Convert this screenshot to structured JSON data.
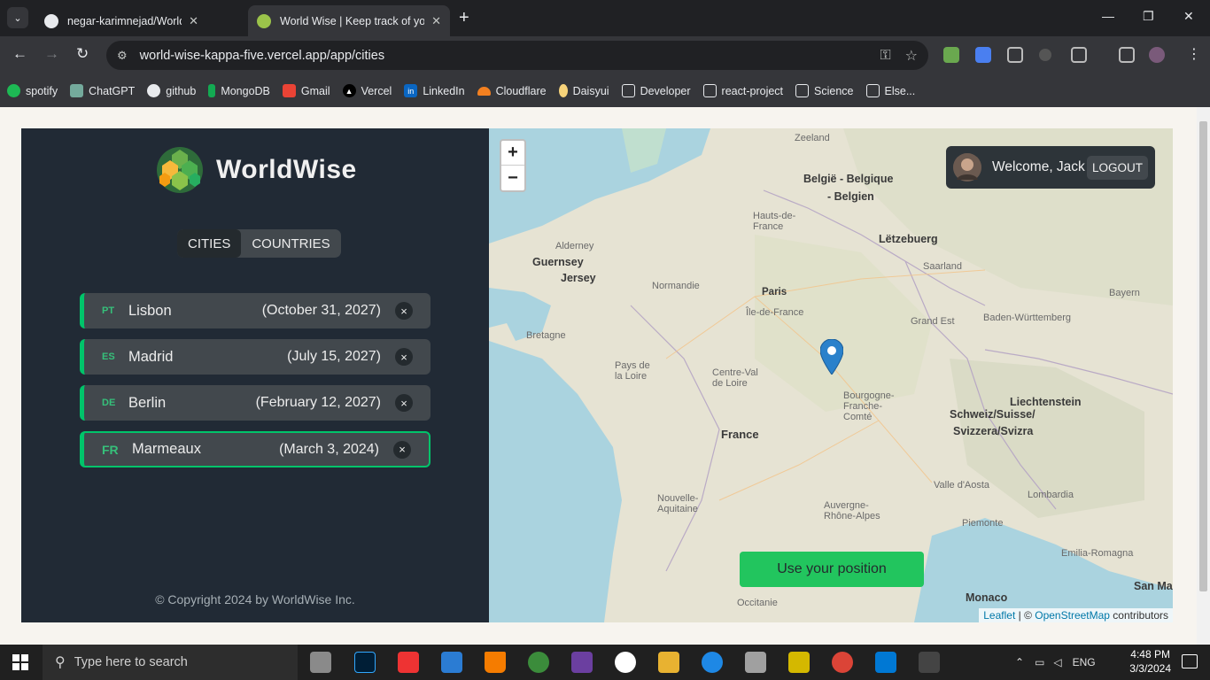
{
  "browser": {
    "tabs": [
      {
        "title": "negar-karimnejad/World-Wise",
        "active": false
      },
      {
        "title": "World Wise | Keep track of your",
        "active": true
      }
    ],
    "url": "world-wise-kappa-five.vercel.app/app/cities",
    "bookmarks": [
      "spotify",
      "ChatGPT",
      "github",
      "MongoDB",
      "Gmail",
      "Vercel",
      "LinkedIn",
      "Cloudflare",
      "Daisyui",
      "Developer",
      "react-project",
      "Science",
      "Else..."
    ]
  },
  "app": {
    "brand": "WorldWise",
    "tabs": {
      "cities": "CITIES",
      "countries": "COUNTRIES"
    },
    "cities": [
      {
        "code": "PT",
        "name": "Lisbon",
        "date": "(October 31, 2027)"
      },
      {
        "code": "ES",
        "name": "Madrid",
        "date": "(July 15, 2027)"
      },
      {
        "code": "DE",
        "name": "Berlin",
        "date": "(February 12, 2027)"
      },
      {
        "code": "FR",
        "name": "Marmeaux",
        "date": "(March 3, 2024)"
      }
    ],
    "delete_label": "×",
    "copyright": "© Copyright 2024 by WorldWise Inc.",
    "accent": "#00c46a"
  },
  "map": {
    "zoom_in": "+",
    "zoom_out": "−",
    "welcome": "Welcome, Jack",
    "logout": "LOGOUT",
    "use_position": "Use your position",
    "attribution": {
      "leaflet": "Leaflet",
      "sep": " | © ",
      "osm": "OpenStreetMap",
      "rest": " contributors"
    },
    "labels": {
      "paris": "Paris",
      "ile": "Île-de-France",
      "france": "France",
      "belgie": "België - Belgique",
      "belgien": "- Belgien",
      "letze": "Lëtzebuerg",
      "guernsey": "Guernsey",
      "jersey": "Jersey",
      "normandie": "Normandie",
      "bretagne": "Bretagne",
      "pays": "Pays de la Loire",
      "centre": "Centre-Val de Loire",
      "bourgogne": "Bourgogne-Franche-Comté",
      "grand": "Grand Est",
      "schweiz1": "Schweiz/Suisse/",
      "schweiz2": "Svizzera/Svizra",
      "liechtenstein": "Liechtenstein",
      "nouvelle": "Nouvelle-Aquitaine",
      "auvergne": "Auvergne-Rhône-Alpes",
      "occitanie": "Occitanie",
      "monaco": "Monaco",
      "sanma": "San Ma",
      "hauts": "Hauts-de-France",
      "baden": "Baden-Württemberg",
      "lombardia": "Lombardia",
      "piemonte": "Piemonte",
      "emilia": "Emilia-Romagna",
      "alderney": "Alderney",
      "bayern": "Bayern",
      "zeeland": "Zeeland",
      "saarland": "Saarland",
      "valle": "Valle d'Aosta"
    }
  },
  "taskbar": {
    "search_placeholder": "Type here to search",
    "lang": "ENG",
    "time": "4:48 PM",
    "date": "3/3/2024"
  }
}
